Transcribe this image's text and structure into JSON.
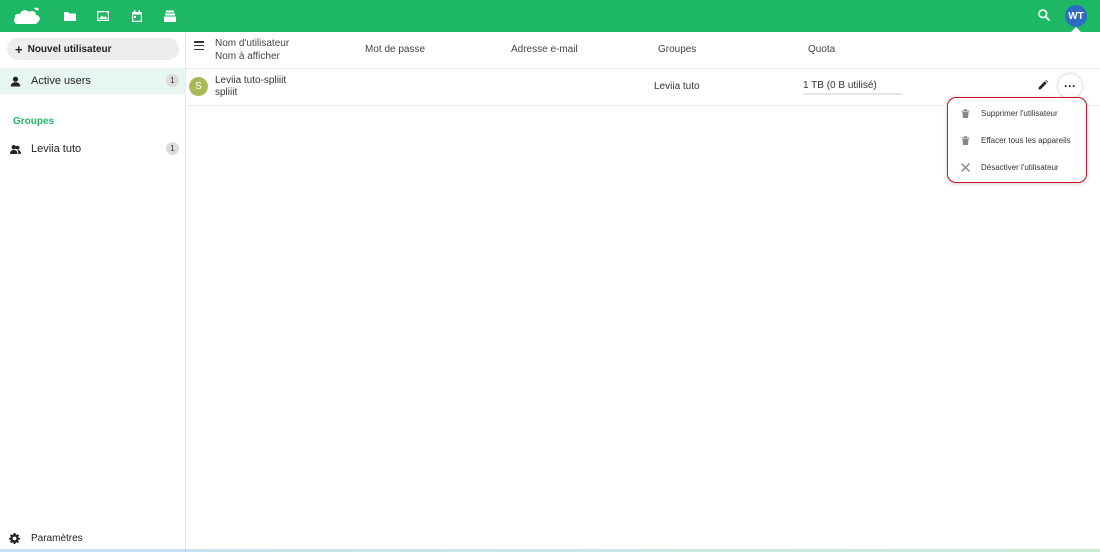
{
  "header": {
    "apps": [
      {
        "icon": "files-icon"
      },
      {
        "icon": "photos-icon"
      },
      {
        "icon": "calendar-icon"
      },
      {
        "icon": "deck-icon"
      }
    ],
    "avatar_initials": "WT",
    "accent_color": "#1eb864"
  },
  "sidebar": {
    "new_user_label": "Nouvel utilisateur",
    "active_users": {
      "label": "Active users",
      "count": "1"
    },
    "groups_heading": "Groupes",
    "groups": [
      {
        "label": "Leviia tuto",
        "count": "1"
      }
    ],
    "settings_label": "Paramètres"
  },
  "table": {
    "columns": {
      "username": "Nom d'utilisateur",
      "display_name": "Nom à afficher",
      "password": "Mot de passe",
      "email": "Adresse e-mail",
      "groups": "Groupes",
      "quota": "Quota"
    },
    "rows": [
      {
        "avatar_letter": "S",
        "display_name": "Leviia tuto-spliiit",
        "username": "spliiit",
        "groups": "Leviia tuto",
        "quota": "1 TB (0 B utilisé)"
      }
    ]
  },
  "actions_menu": {
    "items": [
      {
        "label": "Supprimer l'utilisateur",
        "icon": "trash-icon"
      },
      {
        "label": "Effacer tous les appareils",
        "icon": "trash-icon"
      },
      {
        "label": "Désactiver l'utilisateur",
        "icon": "close-icon"
      }
    ]
  }
}
